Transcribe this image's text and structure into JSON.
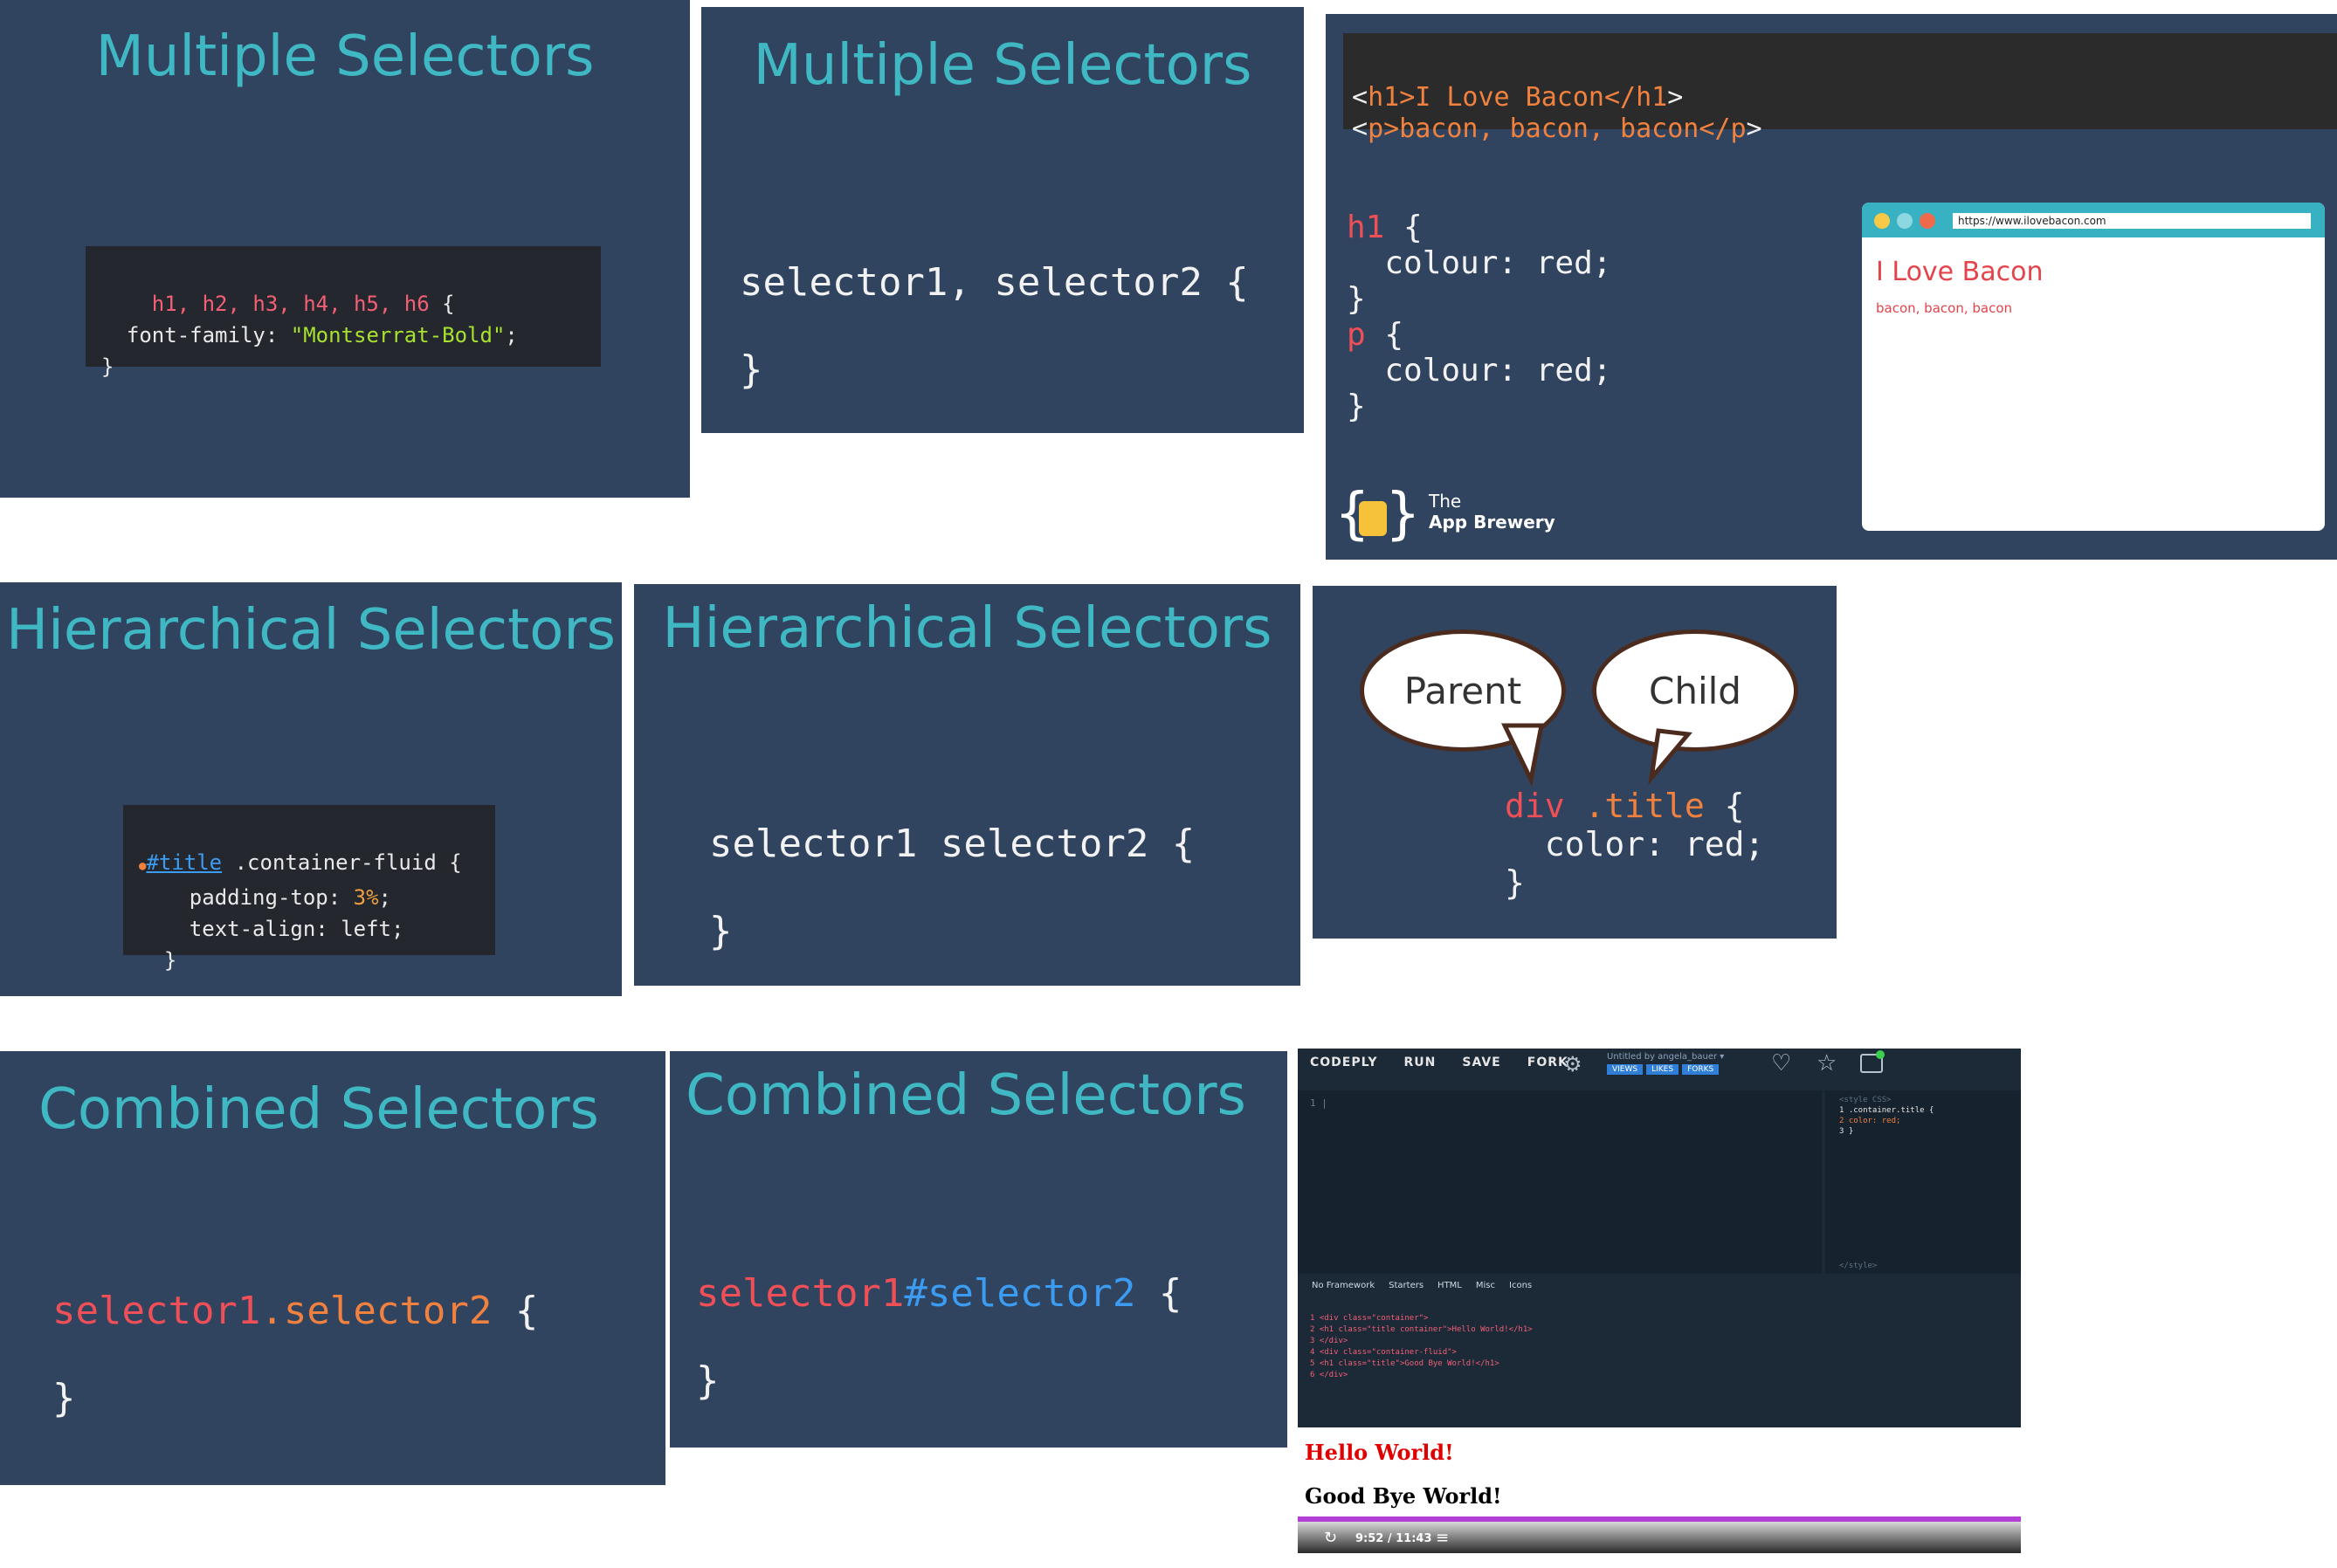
{
  "s1": {
    "title": "Multiple Selectors",
    "l1": [
      "h1, h2, h3, h4, h5, h6",
      " {"
    ],
    "l2": [
      "  font-family: ",
      "\"Montserrat-Bold\"",
      ";"
    ],
    "l3": "}"
  },
  "s2": {
    "title": "Multiple Selectors",
    "line1": "selector1, selector2 {",
    "line2": "}"
  },
  "s3": {
    "html1": [
      "<",
      "h1",
      ">I Love Bacon</",
      "h1",
      ">"
    ],
    "html2": [
      "<",
      "p",
      ">bacon, bacon, bacon</",
      "p",
      ">"
    ],
    "css": [
      [
        "h1",
        " {"
      ],
      [
        "  colour: red;"
      ],
      [
        "}"
      ],
      [
        "p",
        " {"
      ],
      [
        "  colour: red;"
      ],
      [
        "}"
      ]
    ],
    "browser_url": "https://www.ilovebacon.com",
    "browser_h1": "I Love Bacon",
    "browser_p": "bacon, bacon, bacon",
    "logo_line1": "The",
    "logo_line2": "App Brewery"
  },
  "s4": {
    "title": "Hierarchical Selectors",
    "l1": [
      "#title",
      " .container-fluid {"
    ],
    "l2": [
      "    padding-top: ",
      "3%",
      ";"
    ],
    "l3": "    text-align: left;",
    "l4": "  }"
  },
  "s5": {
    "title": "Hierarchical Selectors",
    "line1": "selector1 selector2 {",
    "line2": "}"
  },
  "s6": {
    "parent": "Parent",
    "child": "Child",
    "c1": [
      "div",
      " .title",
      " {"
    ],
    "c2": "  color: red;",
    "c3": "}"
  },
  "s7": {
    "title": "Combined Selectors",
    "sel1": "selector1",
    "sel2": ".selector2",
    "brace": " {",
    "close": "}"
  },
  "s8": {
    "title": "Combined Selectors",
    "sel1": "selector1",
    "sel2": "#selector2",
    "brace": " {",
    "close": "}"
  },
  "s9": {
    "menu": [
      "CODEPLY",
      "RUN",
      "SAVE",
      "FORK"
    ],
    "untitled": "Untitled by angela_bauer ▾",
    "badges": [
      "VIEWS",
      "LIKES",
      "FORKS"
    ],
    "css_lines": [
      "<style CSS>",
      "1 .container.title {",
      "2   color: red;",
      "3 }"
    ],
    "css_end": "</style>",
    "toolbar": [
      "No Framework",
      "Starters",
      "HTML",
      "Misc",
      "Icons"
    ],
    "html_lines": [
      "1 <div class=\"container\">",
      "2   <h1 class=\"title container\">Hello World!</h1>",
      "3 </div>",
      "4 <div class=\"container-fluid\">",
      "5   <h1 class=\"title\">Good Bye World!</h1>",
      "6 </div>"
    ],
    "out1": "Hello World!",
    "out2": "Good Bye World!",
    "time": "9:52 / 11:43"
  },
  "colors": {
    "slide_bg": "#30445f",
    "accent": "#3fb8c4",
    "code_red": "#ef4f57",
    "code_orange": "#f0813f"
  }
}
